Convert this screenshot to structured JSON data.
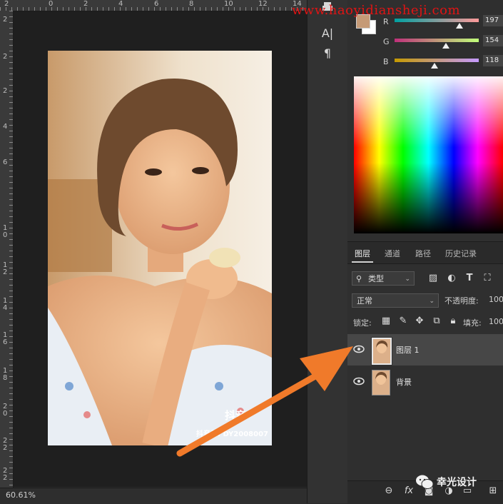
{
  "ruler": {
    "top_labels": [
      "2",
      "0",
      "2",
      "4",
      "6",
      "8",
      "10",
      "12",
      "14"
    ],
    "left_labels": [
      "2",
      "2",
      "2",
      "4",
      "6",
      "10",
      "12",
      "14",
      "16",
      "18",
      "20",
      "22",
      "22"
    ]
  },
  "status": {
    "zoom": "60.61%"
  },
  "tools": {
    "type_tool": "A|",
    "paragraph_tool": "¶"
  },
  "color_panel": {
    "sliders": [
      {
        "letter": "R",
        "value": "197",
        "gradient": "linear-gradient(to right,#00a0a0,#ff9a9a)"
      },
      {
        "letter": "G",
        "value": "154",
        "gradient": "linear-gradient(to right,#c0307a,#c0ff7a)"
      },
      {
        "letter": "B",
        "value": "118",
        "gradient": "linear-gradient(to right,#c59a00,#c59aff)"
      }
    ],
    "foreground": "#c59a76",
    "background": "#ffffff"
  },
  "layers_panel": {
    "tabs": [
      "图层",
      "通道",
      "路径",
      "历史记录"
    ],
    "filter_label": "类型",
    "blend_mode": "正常",
    "opacity_label": "不透明度:",
    "opacity_value": "100",
    "lock_label": "锁定:",
    "fill_label": "填充:",
    "fill_value": "100",
    "layers": [
      {
        "name": "图层 1",
        "selected": true
      },
      {
        "name": "背景",
        "selected": false
      }
    ],
    "footer_icons": [
      "link-icon",
      "fx-icon",
      "mask-icon",
      "adjustment-icon",
      "group-icon",
      "new-layer-icon"
    ],
    "footer_fx": "fx"
  },
  "overlays": {
    "watermark_url": "www.haoyidiansheji.com",
    "photo_watermark": "抖音",
    "photo_watermark_id": "抖音号: DY2008007",
    "brand": "幸光设计",
    "arrow_color": "#f07a2a"
  }
}
